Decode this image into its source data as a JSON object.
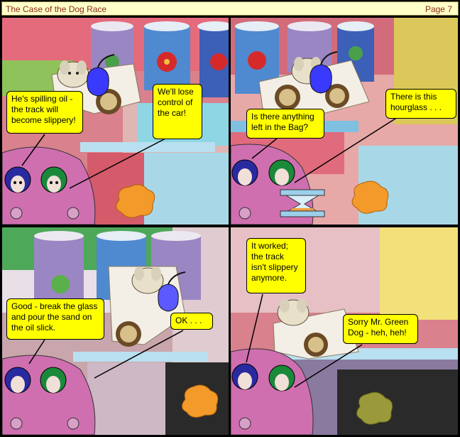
{
  "header": {
    "title": "The Case of the Dog Race",
    "page": "Page 7"
  },
  "colors": {
    "bubble": "#FFFF00",
    "header_bg": "#FFFFC8",
    "header_text": "#8B2B1A",
    "oil_bag": "#3a3aff"
  },
  "panels": [
    {
      "bubbles": [
        {
          "text": "He's spilling oil - the track will become slippery!"
        },
        {
          "text": "We'll lose control of the car!"
        }
      ]
    },
    {
      "bubbles": [
        {
          "text": "Is there anything left in the Bag?"
        },
        {
          "text": "There is this hourglass . . ."
        }
      ]
    },
    {
      "bubbles": [
        {
          "text": "Good - break the glass and pour the sand on the oil slick."
        },
        {
          "text": "OK . . ."
        }
      ]
    },
    {
      "bubbles": [
        {
          "text": "It worked; the track isn't slippery anymore."
        },
        {
          "text": "Sorry Mr. Green Dog - heh, heh!"
        }
      ]
    }
  ]
}
